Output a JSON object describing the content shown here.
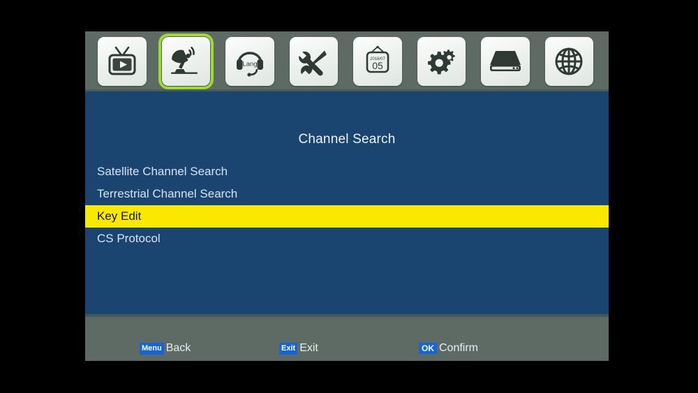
{
  "screen": {
    "background_color": "#000000",
    "osd_background": "#5d6b64",
    "panel_color": "#1b4571",
    "highlight_color": "#fbe800",
    "selection_outline_color": "#9ddb2f",
    "key_badge_color": "#1565d8"
  },
  "iconbar": {
    "items": [
      {
        "name": "tv-icon",
        "label": "Program",
        "selected": false
      },
      {
        "name": "satellite-dish-icon",
        "label": "Channel Search",
        "selected": true
      },
      {
        "name": "headset-lang-icon",
        "label": "Language",
        "selected": false,
        "glyph_text": "Lang"
      },
      {
        "name": "tools-icon",
        "label": "System Setup",
        "selected": false
      },
      {
        "name": "calendar-icon",
        "label": "Time",
        "selected": false,
        "month_year": "2016/07",
        "day": "05"
      },
      {
        "name": "gears-icon",
        "label": "Settings",
        "selected": false
      },
      {
        "name": "hdd-icon",
        "label": "Media",
        "selected": false
      },
      {
        "name": "globe-icon",
        "label": "Network",
        "selected": false
      }
    ]
  },
  "panel": {
    "title": "Channel Search",
    "menu_items": [
      {
        "label": "Satellite Channel Search",
        "highlighted": false
      },
      {
        "label": "Terrestrial Channel Search",
        "highlighted": false
      },
      {
        "label": "Key Edit",
        "highlighted": true
      },
      {
        "label": "CS Protocol",
        "highlighted": false
      }
    ]
  },
  "hintbar": {
    "hints": [
      {
        "key": "Menu",
        "label": "Back"
      },
      {
        "key": "Exit",
        "label": "Exit"
      },
      {
        "key": "OK",
        "label": "Confirm"
      }
    ]
  }
}
